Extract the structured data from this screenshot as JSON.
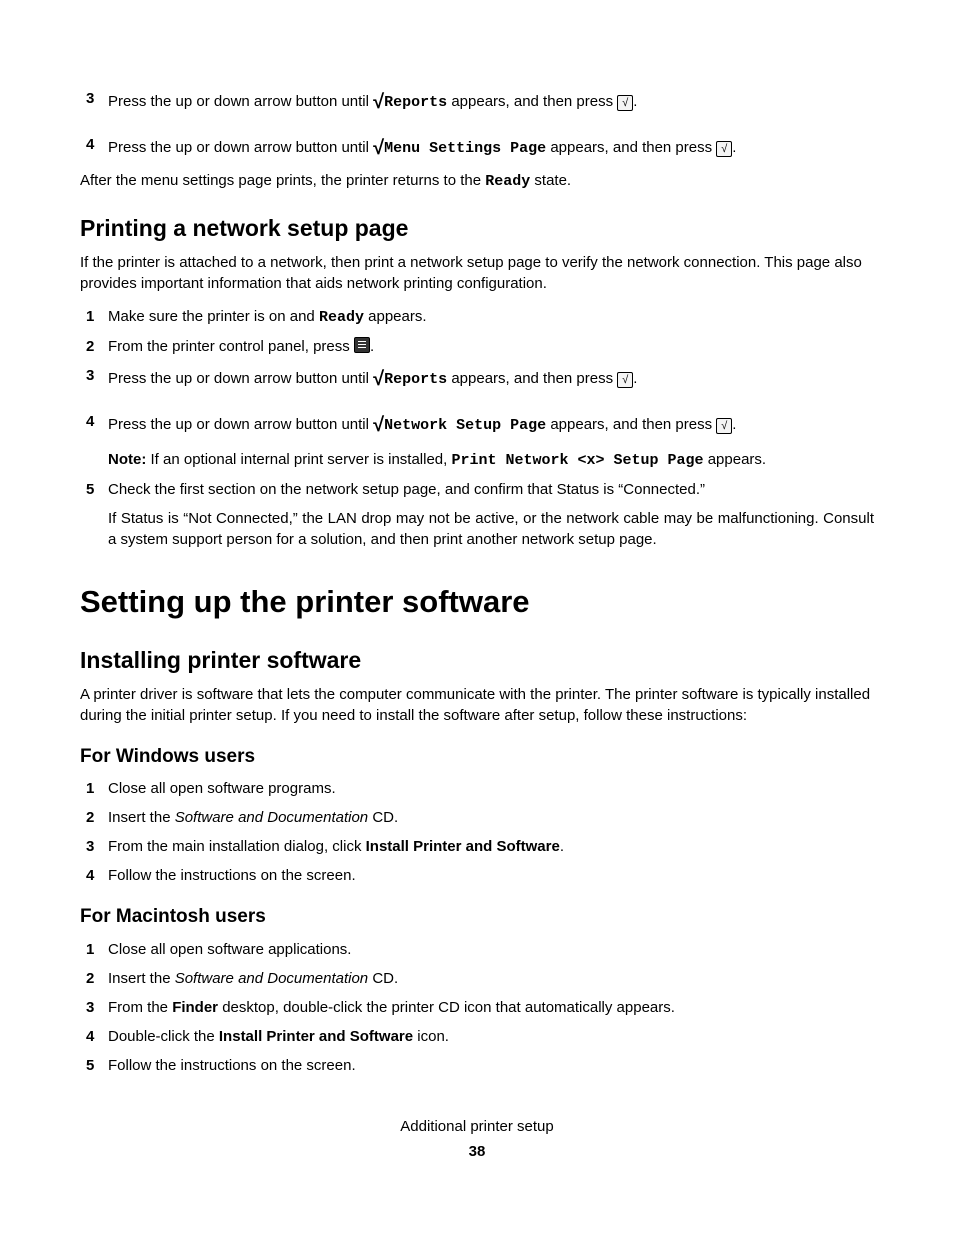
{
  "top_steps": {
    "s3": {
      "num": "3",
      "pre": "Press the up or down arrow button until ",
      "check": "√",
      "mono": "Reports",
      "mid": " appears, and then press ",
      "box": "√",
      "post": "."
    },
    "s4": {
      "num": "4",
      "pre": "Press the up or down arrow button until ",
      "check": "√",
      "mono": "Menu Settings Page",
      "mid": " appears, and then press ",
      "box": "√",
      "post": "."
    }
  },
  "after_menu": {
    "pre": "After the menu settings page prints, the printer returns to the ",
    "mono": "Ready",
    "post": " state."
  },
  "h2_network": "Printing a network setup page",
  "network_intro": "If the printer is attached to a network, then print a network setup page to verify the network connection. This page also provides important information that aids network printing configuration.",
  "net_steps": {
    "s1": {
      "num": "1",
      "pre": "Make sure the printer is on and ",
      "mono": "Ready",
      "post": " appears."
    },
    "s2": {
      "num": "2",
      "pre": "From the printer control panel, press ",
      "post": "."
    },
    "s3": {
      "num": "3",
      "pre": "Press the up or down arrow button until ",
      "check": "√",
      "mono": "Reports",
      "mid": " appears, and then press ",
      "box": "√",
      "post": "."
    },
    "s4": {
      "num": "4",
      "pre": "Press the up or down arrow button until ",
      "check": "√",
      "mono": "Network Setup Page",
      "mid": " appears, and then press ",
      "box": "√",
      "post": "."
    },
    "s4_note": {
      "label": "Note:",
      "pre": " If an optional internal print server is installed, ",
      "mono": "Print Network <x> Setup Page",
      "post": " appears."
    },
    "s5": {
      "num": "5",
      "text": "Check the first section on the network setup page, and confirm that Status is “Connected.”"
    },
    "s5_sub": "If Status is “Not Connected,” the LAN drop may not be active, or the network cable may be malfunctioning. Consult a system support person for a solution, and then print another network setup page."
  },
  "h1_setup": "Setting up the printer software",
  "h2_install": "Installing printer software",
  "install_intro": "A printer driver is software that lets the computer communicate with the printer. The printer software is typically installed during the initial printer setup. If you need to install the software after setup, follow these instructions:",
  "h3_win": "For Windows users",
  "win_steps": {
    "s1": {
      "num": "1",
      "text": "Close all open software programs."
    },
    "s2": {
      "num": "2",
      "pre": "Insert the ",
      "italic": "Software and Documentation",
      "post": " CD."
    },
    "s3": {
      "num": "3",
      "pre": "From the main installation dialog, click ",
      "bold": "Install Printer and Software",
      "post": "."
    },
    "s4": {
      "num": "4",
      "text": "Follow the instructions on the screen."
    }
  },
  "h3_mac": "For Macintosh users",
  "mac_steps": {
    "s1": {
      "num": "1",
      "text": "Close all open software applications."
    },
    "s2": {
      "num": "2",
      "pre": "Insert the ",
      "italic": "Software and Documentation",
      "post": " CD."
    },
    "s3": {
      "num": "3",
      "pre": "From the ",
      "bold": "Finder",
      "post": " desktop, double-click the printer CD icon that automatically appears."
    },
    "s4": {
      "num": "4",
      "pre": "Double-click the ",
      "bold": "Install Printer and Software",
      "post": " icon."
    },
    "s5": {
      "num": "5",
      "text": "Follow the instructions on the screen."
    }
  },
  "footer": {
    "section": "Additional printer setup",
    "page": "38"
  }
}
